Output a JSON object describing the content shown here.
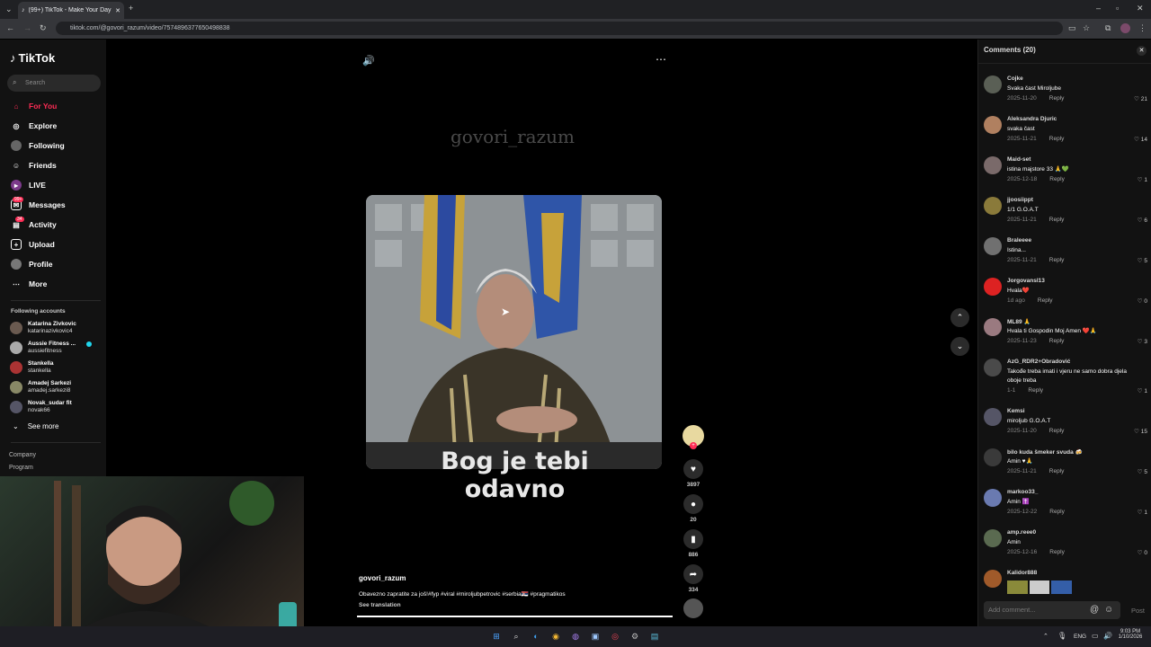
{
  "browser": {
    "tab_title": "(99+) TikTok - Make Your Day",
    "url": "tiktok.com/@govori_razum/video/7574896377650498838"
  },
  "sidebar": {
    "logo": "TikTok",
    "search_placeholder": "Search",
    "nav": [
      {
        "label": "For You",
        "icon": "home-icon",
        "active": true
      },
      {
        "label": "Explore",
        "icon": "compass-icon"
      },
      {
        "label": "Following",
        "icon": "following-icon"
      },
      {
        "label": "Friends",
        "icon": "friends-icon"
      },
      {
        "label": "LIVE",
        "icon": "live-icon"
      },
      {
        "label": "Messages",
        "icon": "messages-icon",
        "badge": "99+"
      },
      {
        "label": "Activity",
        "icon": "activity-icon",
        "badge": "34"
      },
      {
        "label": "Upload",
        "icon": "upload-icon"
      },
      {
        "label": "Profile",
        "icon": "profile-icon"
      },
      {
        "label": "More",
        "icon": "more-icon"
      }
    ],
    "following_title": "Following accounts",
    "accounts": [
      {
        "name": "Katarina Zivkovic",
        "handle": "katarinazivkovic4"
      },
      {
        "name": "Aussie Fitness ...",
        "handle": "aussiefitness"
      },
      {
        "name": "Stankella",
        "handle": "stankella"
      },
      {
        "name": "Amadej Sarkezi",
        "handle": "amadej.sarkezi8"
      },
      {
        "name": "Novak_sudar fit",
        "handle": "novak66"
      }
    ],
    "see_more": "See more",
    "footer": [
      "Company",
      "Program"
    ]
  },
  "video": {
    "watermark": "govori_razum",
    "caption_line1": "Bog je tebi",
    "caption_line2": "odavno",
    "author": "govori_razum",
    "description": "Obavezno zapratite za još!#fyp #viral #miroljubpetrovic #serbia🇷🇸 #pragmatikos",
    "see_translation": "See translation",
    "likes": "3897",
    "comments": "20",
    "saves": "886",
    "shares": "334"
  },
  "comments_panel": {
    "title": "Comments (20)",
    "add_placeholder": "Add comment...",
    "post_label": "Post",
    "reply_label": "Reply",
    "items": [
      {
        "user": "Cojke",
        "text": "Svaka čast Miroljube",
        "date": "2025-11-20",
        "likes": "21"
      },
      {
        "user": "Aleksandra Djuric",
        "text": "svaka čast",
        "date": "2025-11-21",
        "likes": "14"
      },
      {
        "user": "Maid-set",
        "text": "istina majstore 33 🙏💚",
        "date": "2025-12-18",
        "likes": "1"
      },
      {
        "user": "jjoosiippt",
        "text": "1/1 G.O.A.T",
        "date": "2025-11-21",
        "likes": "6"
      },
      {
        "user": "Braleeee",
        "text": "Istina...",
        "date": "2025-11-21",
        "likes": "5"
      },
      {
        "user": "Jorgovansl13",
        "text": "Hvala❤️",
        "date": "1d ago",
        "likes": "0"
      },
      {
        "user": "ML89 🙏",
        "text": "Hvala ti Gospodin Moj Amen ❤️🙏",
        "date": "2025-11-23",
        "likes": "3"
      },
      {
        "user": "AzG_RDR2+Obradović",
        "text": "Takođe treba imati i vjeru ne samo dobra djela oboje treba",
        "date": "1-1",
        "likes": "1"
      },
      {
        "user": "Kemsi",
        "text": "miroljub G.O.A.T",
        "date": "2025-11-20",
        "likes": "15"
      },
      {
        "user": "bilo kuda šmeker svuda 🍻",
        "text": "Amin ♥🙏",
        "date": "2025-11-21",
        "likes": "5"
      },
      {
        "user": "markoo33_",
        "text": "Amin ✝️",
        "date": "2025-12-22",
        "likes": "1"
      },
      {
        "user": "amp.reee0",
        "text": "Amin",
        "date": "2025-12-16",
        "likes": "0"
      },
      {
        "user": "Kalidor888",
        "text": "",
        "date": "",
        "likes": ""
      }
    ]
  },
  "taskbar": {
    "lang": "ENG",
    "time": "9:03 PM",
    "date": "1/10/2026"
  },
  "colors": {
    "accent": "#fe2c55",
    "panel": "#121212"
  }
}
